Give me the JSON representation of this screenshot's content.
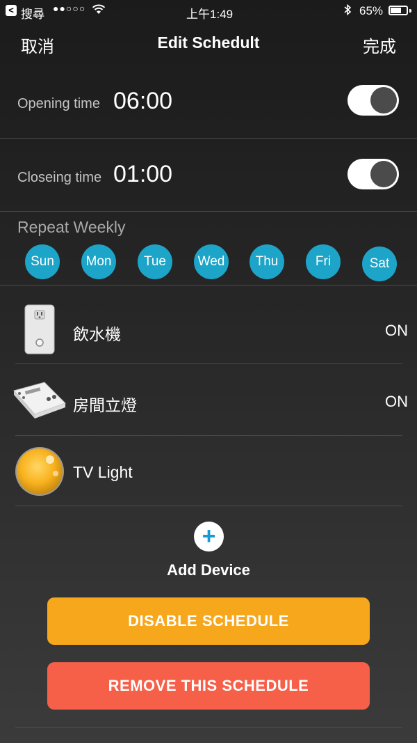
{
  "status_bar": {
    "back_glyph": "<",
    "back_app": "搜尋",
    "signal": "●●○○○",
    "time": "上午1:49",
    "battery": "65%"
  },
  "nav": {
    "cancel": "取消",
    "title": "Edit Schedult",
    "done": "完成"
  },
  "opening": {
    "label": "Opening time",
    "value": "06:00",
    "enabled": true
  },
  "closing": {
    "label": "Closeing time",
    "value": "01:00",
    "enabled": true
  },
  "repeat": {
    "label": "Repeat Weekly",
    "days": [
      "Sun",
      "Mon",
      "Tue",
      "Wed",
      "Thu",
      "Fri",
      "Sat"
    ]
  },
  "devices": [
    {
      "name": "飲水機",
      "state": "ON",
      "icon": "smart-plug-icon"
    },
    {
      "name": "房間立燈",
      "state": "ON",
      "icon": "wifi-switch-module-icon"
    },
    {
      "name": "TV Light",
      "state": "",
      "icon": "bulb-icon"
    }
  ],
  "add_device": {
    "symbol": "+",
    "label": "Add Device"
  },
  "buttons": {
    "disable": "DISABLE SCHEDULE",
    "remove": "REMOVE THIS SCHEDULE"
  },
  "colors": {
    "accent_blue": "#1da4c9",
    "disable_orange": "#f7a71b",
    "remove_red": "#f65f48"
  }
}
